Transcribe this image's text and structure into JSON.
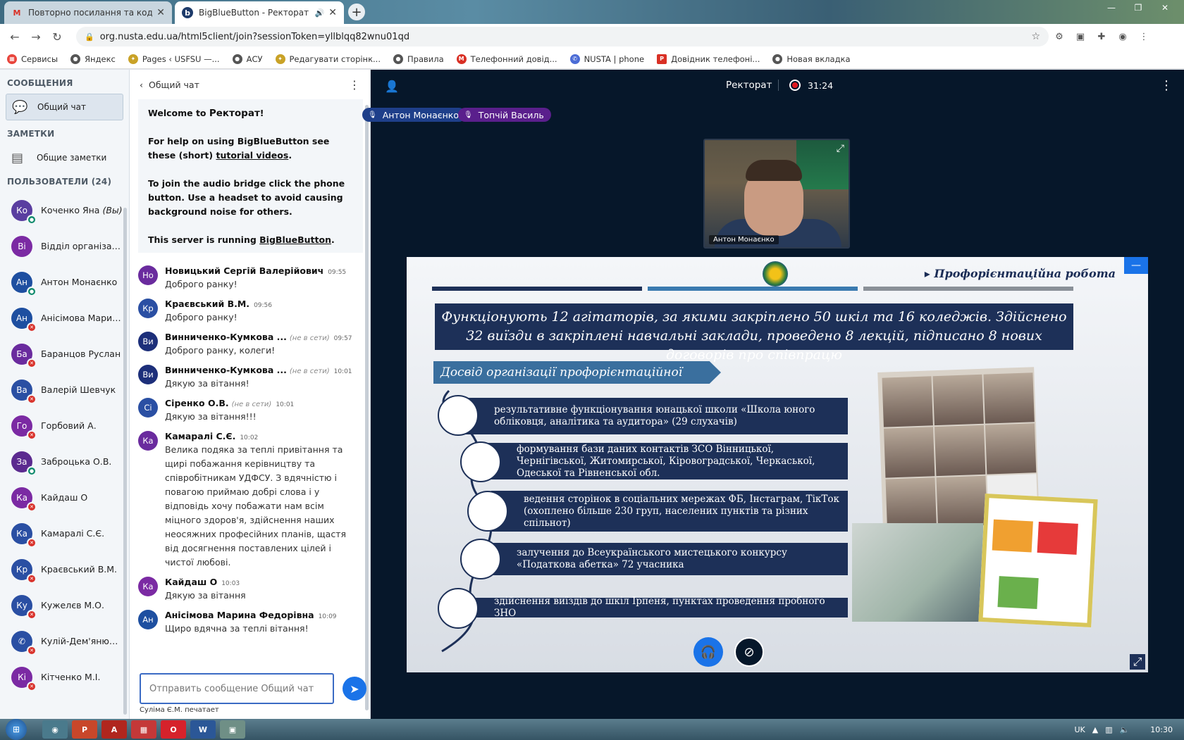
{
  "browser": {
    "tabs": [
      {
        "title": "Повторно посилання та код до",
        "icon": "gmail-icon",
        "active": false
      },
      {
        "title": "BigBlueButton - Ректорат",
        "icon": "bigbluebutton-icon",
        "active": true
      }
    ],
    "url": "org.nusta.edu.ua/html5client/join?sessionToken=yllblqq82wnu01qd",
    "bookmarks": [
      {
        "label": "Сервисы",
        "icon": "apps-icon",
        "color": "#e8453c"
      },
      {
        "label": "Яндекс",
        "icon": "globe-icon",
        "color": "#555555"
      },
      {
        "label": "Pages ‹ USFSU —...",
        "icon": "emblem-icon",
        "color": "#c9a227"
      },
      {
        "label": "АСУ",
        "icon": "globe-icon",
        "color": "#555555"
      },
      {
        "label": "Редагувати сторінк...",
        "icon": "emblem-icon",
        "color": "#c9a227"
      },
      {
        "label": "Правила",
        "icon": "globe-icon",
        "color": "#555555"
      },
      {
        "label": "Телефонний довід...",
        "icon": "gmail-icon",
        "color": "#d93025"
      },
      {
        "label": "NUSTA | phone",
        "icon": "phone-icon",
        "color": "#4b6cd6"
      },
      {
        "label": "Довідник телефоні...",
        "icon": "pdf-icon",
        "color": "#d93025"
      },
      {
        "label": "Новая вкладка",
        "icon": "globe-icon",
        "color": "#555555"
      }
    ]
  },
  "sidebar": {
    "messages_heading": "СООБЩЕНИЯ",
    "public_chat": "Общий чат",
    "notes_heading": "ЗАМЕТКИ",
    "shared_notes": "Общие заметки",
    "users_heading": "ПОЛЬЗОВАТЕЛИ (24)",
    "users": [
      {
        "initials": "Ко",
        "name": "Коченко Яна",
        "suffix": "(Вы)",
        "color": "#5a3ea0",
        "mic": "on"
      },
      {
        "initials": "Ві",
        "name": "Відділ організації ...",
        "suffix": "",
        "color": "#7b2aa3",
        "mic": "none"
      },
      {
        "initials": "Ан",
        "name": "Антон Монаєнко",
        "suffix": "",
        "color": "#1e4fa0",
        "mic": "on"
      },
      {
        "initials": "Ан",
        "name": "Анісімова Марин...",
        "suffix": "",
        "color": "#1e4fa0",
        "mic": "muted"
      },
      {
        "initials": "Ба",
        "name": "Баранцов Руслан",
        "suffix": "",
        "color": "#6a2b9e",
        "mic": "muted"
      },
      {
        "initials": "Ва",
        "name": "Валерій Шевчук",
        "suffix": "",
        "color": "#2a4fa3",
        "mic": "muted"
      },
      {
        "initials": "Го",
        "name": "Горбовий А.",
        "suffix": "",
        "color": "#7b2aa3",
        "mic": "muted"
      },
      {
        "initials": "За",
        "name": "Заброцька О.В.",
        "suffix": "",
        "color": "#5b2a8f",
        "mic": "on"
      },
      {
        "initials": "Ка",
        "name": "Кайдаш О",
        "suffix": "",
        "color": "#7b2aa3",
        "mic": "muted"
      },
      {
        "initials": "Ка",
        "name": "Камаралі С.Є.",
        "suffix": "",
        "color": "#2a4fa3",
        "mic": "muted"
      },
      {
        "initials": "Кр",
        "name": "Краєвський В.М.",
        "suffix": "",
        "color": "#2a4fa3",
        "mic": "muted"
      },
      {
        "initials": "Ку",
        "name": "Кужелєв М.О.",
        "suffix": "",
        "color": "#2a4fa3",
        "mic": "muted"
      },
      {
        "initials": "✆",
        "name": "Кулій-Дем'янюк Ю.",
        "suffix": "",
        "color": "#2a4fa3",
        "mic": "muted"
      },
      {
        "initials": "Кі",
        "name": "Кітченко М.І.",
        "suffix": "",
        "color": "#7b2aa3",
        "mic": "muted"
      }
    ]
  },
  "chat": {
    "title": "Общий чат",
    "welcome": {
      "line1_prefix": "Welcome to ",
      "line1_room": "Ректорат",
      "line1_suffix": "!",
      "help_prefix": "For help on using BigBlueButton see these (short) ",
      "help_link": "tutorial videos",
      "help_suffix": ".",
      "audio": "To join the audio bridge click the phone button. Use a headset to avoid causing background noise for others.",
      "server_prefix": "This server is running ",
      "server_link": "BigBlueButton",
      "server_suffix": "."
    },
    "messages": [
      {
        "initials": "Но",
        "color": "#6a2b9e",
        "name": "Новицький Сергій Валерійович",
        "offline": "",
        "time": "09:55",
        "text": "Доброго ранку!"
      },
      {
        "initials": "Кр",
        "color": "#2a4fa3",
        "name": "Краєвський В.М.",
        "offline": "",
        "time": "09:56",
        "text": "Доброго ранку!"
      },
      {
        "initials": "Ви",
        "color": "#1d2f7a",
        "name": "Винниченко-Кумкова ...",
        "offline": "(не в сети)",
        "time": "09:57",
        "text": "Доброго ранку, колеги!"
      },
      {
        "initials": "Ви",
        "color": "#1d2f7a",
        "name": "Винниченко-Кумкова ...",
        "offline": "(не в сети)",
        "time": "10:01",
        "text": "Дякую за вітання!"
      },
      {
        "initials": "Сі",
        "color": "#2a4fa3",
        "name": "Сіренко О.В.",
        "offline": "(не в сети)",
        "time": "10:01",
        "text": "Дякую за вітання!!!"
      },
      {
        "initials": "Ка",
        "color": "#6a2b9e",
        "name": "Камаралі С.Є.",
        "offline": "",
        "time": "10:02",
        "text": "Велика подяка за теплі привітання та щирі побажання керівництву та співробітникам УДФСУ. З вдячністю і повагою приймаю добрі слова і у відповідь хочу побажати нам всім міцного здоров'я, здійснення наших неосяжних професійних планів, щастя від досягнення поставлених цілей і чистої любові."
      },
      {
        "initials": "Ка",
        "color": "#7b2aa3",
        "name": "Кайдаш О",
        "offline": "",
        "time": "10:03",
        "text": "Дякую за вітання"
      },
      {
        "initials": "Ан",
        "color": "#1e4fa0",
        "name": "Анісімова Марина Федорівна",
        "offline": "",
        "time": "10:09",
        "text": "Щиро вдячна за теплі вітання!"
      }
    ],
    "input_placeholder": "Отправить сообщение Общий чат",
    "typing": "Суліма Є.М. печатает"
  },
  "meeting": {
    "room": "Ректорат",
    "record_time": "31:24",
    "talkers": [
      {
        "name": "Антон Монаєнко",
        "color": "#1e3f8a"
      },
      {
        "name": "Топчій Василь",
        "color": "#5a1f8c"
      }
    ],
    "video_name": "Антон Монаєнко"
  },
  "slide": {
    "title": "Профорієнтаційна робота",
    "banner": "Функціонують 12 агітаторів, за якими закріплено 50 шкіл та 16 коледжів. Здійснено 32 виїзди в закріплені навчальні заклади, проведено 8 лекцій, підписано 8 нових договорів про співпрацю",
    "section": "Досвід організації профорієнтаційної роботи",
    "steps": [
      "результативне функціонування юнацької школи «Школа юного обліковця, аналітика та аудитора» (29 слухачів)",
      "формування бази даних контактів ЗСО Вінницької, Чернігівської, Житомирської, Кіровоградської, Черкаської, Одеської та Рівненської обл.",
      "ведення сторінок в соціальних мережах ФБ, Інстаграм, ТікТок (охоплено більше 230 груп, населених пунктів та різних спільнот)",
      "залучення до Всеукраїнського мистецького конкурсу «Податкова абетка» 72 учасника",
      "здійснення виїздів до шкіл Ірпеня, пунктах проведення пробного ЗНО"
    ],
    "bar_colors": [
      "#1d3058",
      "#3a7ab0",
      "#8a9098"
    ]
  },
  "taskbar": {
    "apps": [
      "chrome-icon",
      "powerpoint-icon",
      "acrobat-icon",
      "pdf-editor-icon",
      "opera-icon",
      "word-icon",
      "explorer-icon"
    ],
    "lang": "UK",
    "clock": "10:30"
  }
}
